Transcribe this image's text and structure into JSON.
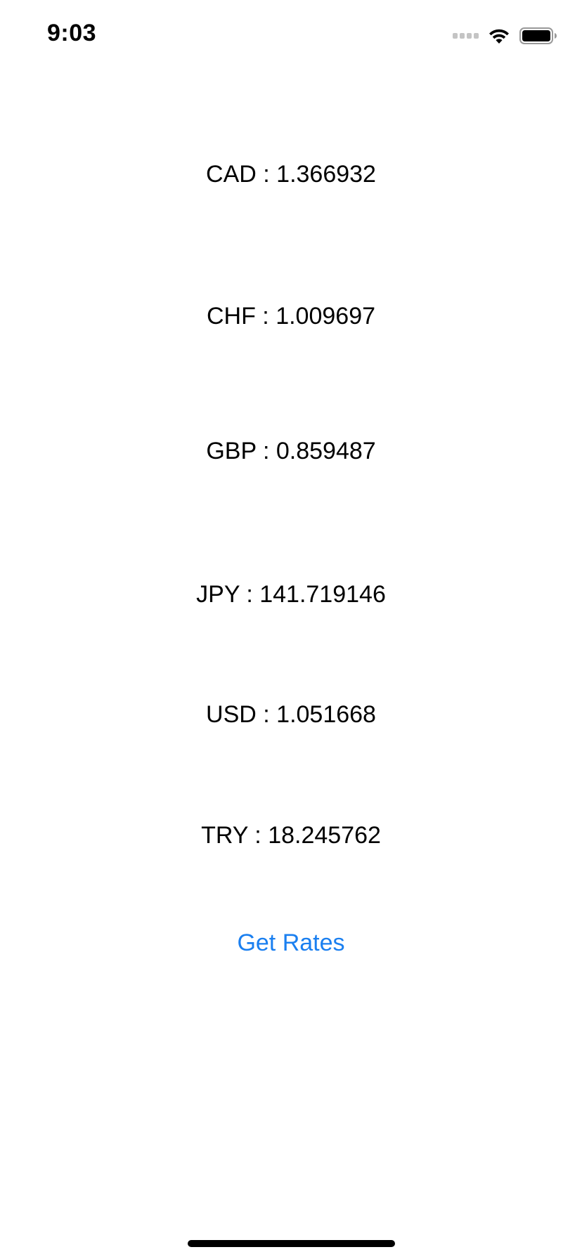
{
  "status_bar": {
    "time": "9:03"
  },
  "rates": [
    {
      "label": "CAD : 1.366932"
    },
    {
      "label": "CHF : 1.009697"
    },
    {
      "label": "GBP : 0.859487"
    },
    {
      "label": "JPY : 141.719146"
    },
    {
      "label": "USD : 1.051668"
    },
    {
      "label": "TRY : 18.245762"
    }
  ],
  "actions": {
    "get_rates_label": "Get Rates"
  },
  "colors": {
    "accent": "#1a7ff0",
    "text": "#000000",
    "background": "#ffffff"
  }
}
